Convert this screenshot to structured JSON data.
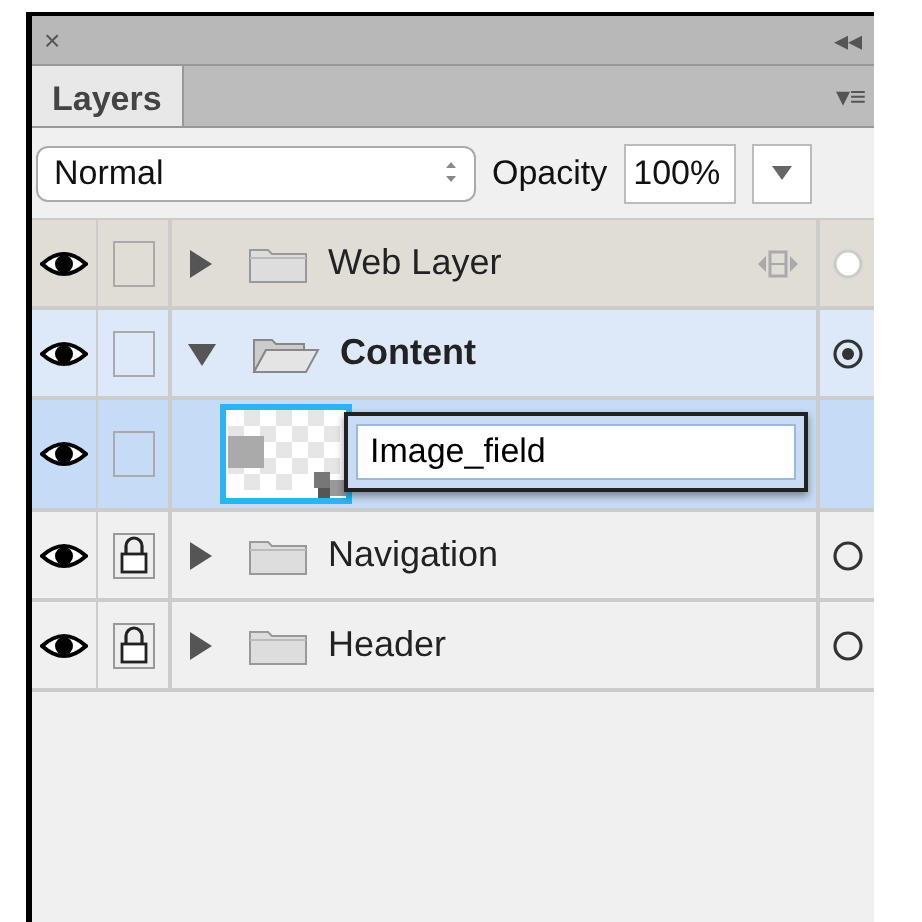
{
  "panel": {
    "close_glyph": "×",
    "collapse_glyph": "◂◂",
    "tab": "Layers",
    "menu_glyph": "▾≡"
  },
  "toolbar": {
    "blend_mode": "Normal",
    "opacity_label": "Opacity",
    "opacity": "100%"
  },
  "layers": [
    {
      "kind": "folder",
      "name": "Web Layer",
      "visible": true,
      "locked": false,
      "expanded": false,
      "selected": false,
      "targeted": false,
      "web": true
    },
    {
      "kind": "folder",
      "name": "Content",
      "visible": true,
      "locked": false,
      "expanded": true,
      "selected": true,
      "targeted": true,
      "web": false,
      "children": [
        {
          "kind": "image",
          "visible": true,
          "locked": false,
          "selected": true,
          "rename_value": "Image_field"
        }
      ]
    },
    {
      "kind": "folder",
      "name": "Navigation",
      "visible": true,
      "locked": true,
      "expanded": false,
      "selected": false,
      "targeted": false,
      "web": false
    },
    {
      "kind": "folder",
      "name": "Header",
      "visible": true,
      "locked": true,
      "expanded": false,
      "selected": false,
      "targeted": false,
      "web": false
    }
  ]
}
